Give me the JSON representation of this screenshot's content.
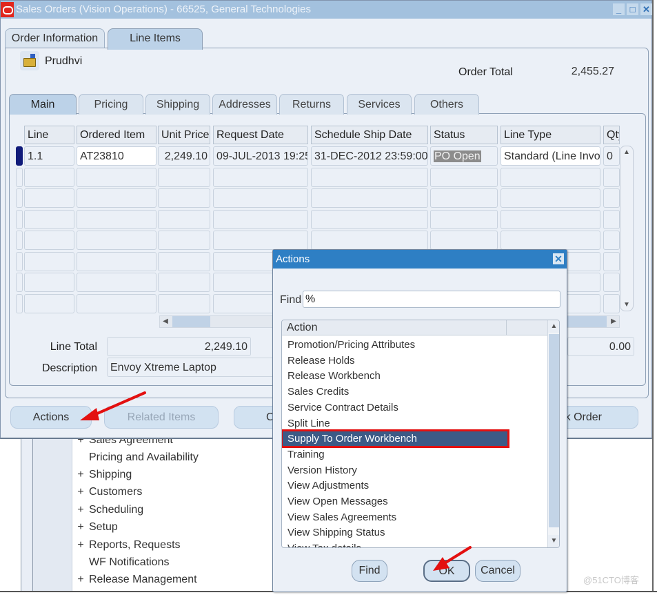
{
  "window": {
    "title": "Sales Orders (Vision Operations) - 66525, General Technologies",
    "controls": {
      "minimize": "_",
      "maximize": "□",
      "close": "✕"
    }
  },
  "top_tabs": [
    {
      "label": "Order Information",
      "active": false
    },
    {
      "label": "Line Items",
      "active": true
    }
  ],
  "header": {
    "user_name": "Prudhvi",
    "order_total_label": "Order Total",
    "order_total_value": "2,455.27"
  },
  "sub_tabs": [
    {
      "label": "Main",
      "active": true
    },
    {
      "label": "Pricing",
      "active": false
    },
    {
      "label": "Shipping",
      "active": false
    },
    {
      "label": "Addresses",
      "active": false
    },
    {
      "label": "Returns",
      "active": false
    },
    {
      "label": "Services",
      "active": false
    },
    {
      "label": "Others",
      "active": false
    }
  ],
  "grid": {
    "columns": [
      "Line",
      "Ordered Item",
      "Unit Price",
      "Request Date",
      "Schedule Ship Date",
      "Status",
      "Line Type",
      "Qty"
    ],
    "rows": [
      {
        "line": "1.1",
        "ordered_item": "AT23810",
        "unit_price": "2,249.10",
        "request_date": "09-JUL-2013 19:25",
        "schedule_ship_date": "31-DEC-2012 23:59:00",
        "status": "PO Open",
        "line_type": "Standard (Line Invo",
        "qty": "0"
      }
    ]
  },
  "details": {
    "line_total_label": "Line Total",
    "line_total_value": "2,249.10",
    "description_label": "Description",
    "description_value": "Envoy Xtreme Laptop",
    "right_value": "0.00"
  },
  "bottom_buttons": {
    "actions": "Actions",
    "related_items": "Related Items",
    "partial_c": "C",
    "book_order_partial": "k Order"
  },
  "navigator": {
    "items": [
      {
        "label": "Sales Agreement",
        "expandable": true
      },
      {
        "label": "Pricing and Availability",
        "expandable": false
      },
      {
        "label": "Shipping",
        "expandable": true
      },
      {
        "label": "Customers",
        "expandable": true
      },
      {
        "label": "Scheduling",
        "expandable": true
      },
      {
        "label": "Setup",
        "expandable": true
      },
      {
        "label": "Reports, Requests",
        "expandable": true
      },
      {
        "label": "WF Notifications",
        "expandable": false
      },
      {
        "label": "Release Management",
        "expandable": true
      }
    ],
    "plus": "+"
  },
  "actions_dialog": {
    "title": "Actions",
    "find_label": "Find",
    "find_value": "%",
    "list_header": "Action",
    "items": [
      "Promotion/Pricing Attributes",
      "Release Holds",
      "Release Workbench",
      "Sales Credits",
      "Service Contract Details",
      "Split Line",
      "Supply To Order Workbench",
      "Training",
      "Version History",
      "View Adjustments",
      "View Open Messages",
      "View Sales Agreements",
      "View Shipping Status",
      "View Tax details"
    ],
    "selected_item": "Supply To Order Workbench",
    "buttons": {
      "find": "Find",
      "ok": "OK",
      "cancel": "Cancel"
    }
  },
  "colors": {
    "titlebar": "#a3c1de",
    "dialog_title": "#2e7fc4",
    "selection": "#3c5a86",
    "highlight_box": "#e31010",
    "annotation_arrow": "#e31010",
    "current_row_marker": "#101b7a"
  },
  "watermark": "@51CTO博客"
}
